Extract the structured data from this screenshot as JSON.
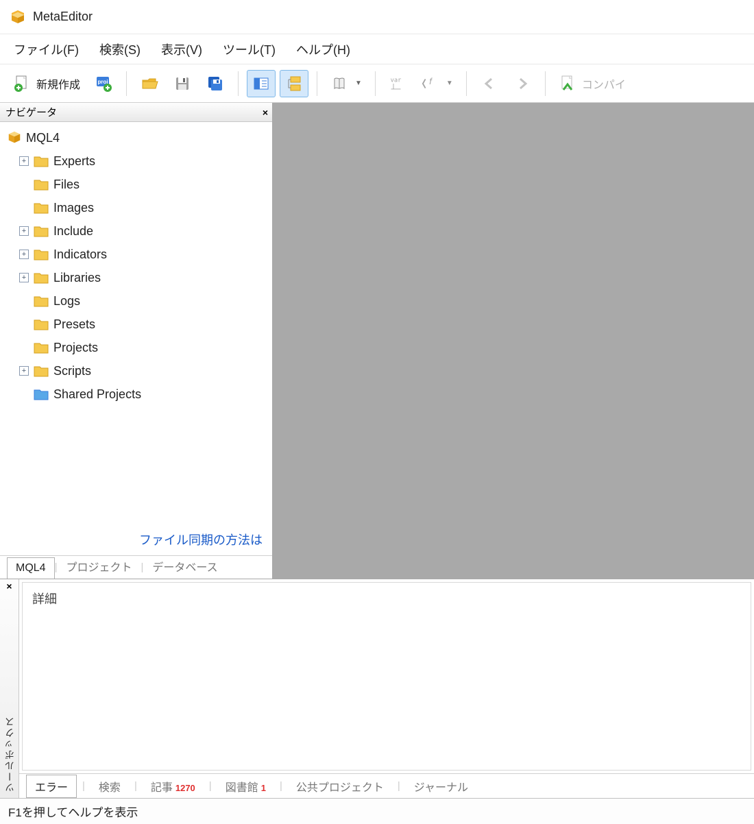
{
  "title": "MetaEditor",
  "menubar": [
    "ファイル(F)",
    "検索(S)",
    "表示(V)",
    "ツール(T)",
    "ヘルプ(H)"
  ],
  "toolbar": {
    "new_label": "新規作成",
    "compile_label": "コンパイ"
  },
  "navigator": {
    "title": "ナビゲータ",
    "root": "MQL4",
    "items": [
      {
        "label": "Experts",
        "expandable": true
      },
      {
        "label": "Files",
        "expandable": false
      },
      {
        "label": "Images",
        "expandable": false
      },
      {
        "label": "Include",
        "expandable": true
      },
      {
        "label": "Indicators",
        "expandable": true
      },
      {
        "label": "Libraries",
        "expandable": true
      },
      {
        "label": "Logs",
        "expandable": false
      },
      {
        "label": "Presets",
        "expandable": false
      },
      {
        "label": "Projects",
        "expandable": false
      },
      {
        "label": "Scripts",
        "expandable": true
      },
      {
        "label": "Shared Projects",
        "expandable": false,
        "blue": true
      }
    ],
    "footer_link": "ファイル同期の方法は",
    "tabs": [
      "MQL4",
      "プロジェクト",
      "データベース"
    ]
  },
  "toolbox": {
    "side_label": "ツールボックス",
    "content_header": "詳細",
    "tabs": [
      {
        "label": "エラー",
        "badge": ""
      },
      {
        "label": "検索",
        "badge": ""
      },
      {
        "label": "記事",
        "badge": "1270"
      },
      {
        "label": "図書館",
        "badge": "1"
      },
      {
        "label": "公共プロジェクト",
        "badge": ""
      },
      {
        "label": "ジャーナル",
        "badge": ""
      }
    ]
  },
  "statusbar": "F1を押してヘルプを表示"
}
